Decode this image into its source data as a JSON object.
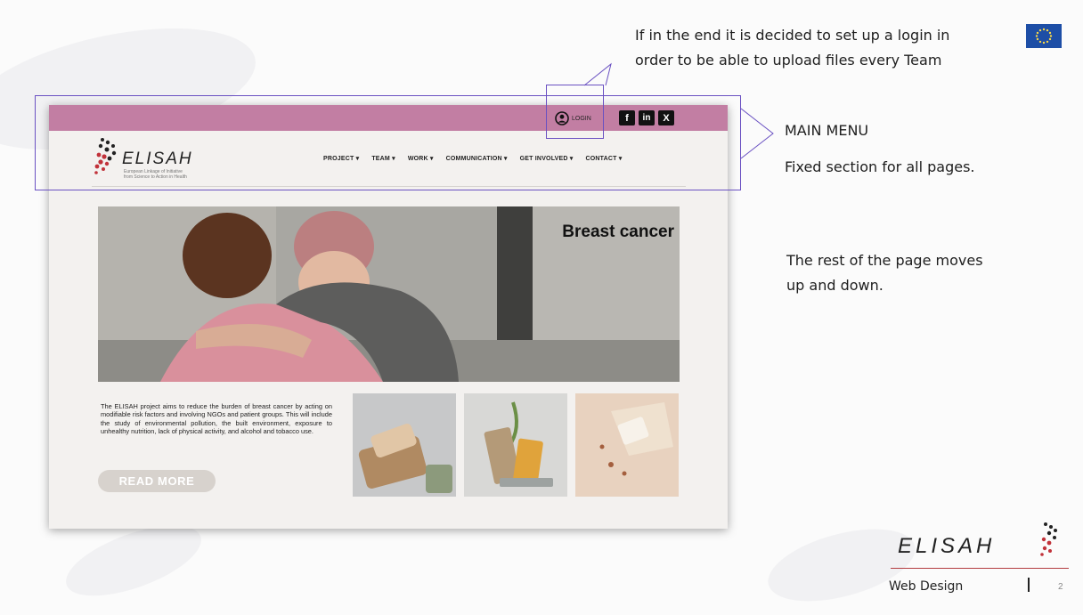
{
  "slide": {
    "annotation_login": [
      "If in the end it is decided to set up a login in",
      "order to be able to upload files every Team"
    ],
    "main_menu_title": "MAIN MENU",
    "main_menu_desc": "Fixed section for all pages.",
    "rest_desc": [
      "The rest of the page moves",
      "up and down."
    ],
    "footer_label": "Web Design",
    "page_number": "2",
    "footer_logo_text": "ELISAH"
  },
  "site": {
    "login_label": "LOGIN",
    "socials": [
      {
        "label": "f",
        "icon": "facebook-icon"
      },
      {
        "label": "in",
        "icon": "linkedin-icon"
      },
      {
        "label": "X",
        "icon": "x-icon"
      }
    ],
    "logo": {
      "name": "ELISAH",
      "tagline_1": "European Linkage of Initiative",
      "tagline_2": "from Science to Action in Health"
    },
    "nav": [
      "PROJECT ▾",
      "TEAM ▾",
      "WORK ▾",
      "COMMUNICATION ▾",
      "GET INVOLVED ▾",
      "CONTACT ▾"
    ],
    "hero_title": "Breast cancer",
    "intro_text": "The ELISAH project aims to reduce the burden of breast cancer by acting on modifiable risk factors and involving NGOs and patient groups. This will include the study of environmental pollution, the built environment, exposure to unhealthy nutrition, lack of physical activity, and alcohol and tobacco use.",
    "read_more": "READ MORE"
  },
  "colors": {
    "topbar": "#c27ea3",
    "annotation_border": "#6a51c2",
    "eu_flag": "#1d4ea6",
    "footer_line": "#b33c40"
  }
}
